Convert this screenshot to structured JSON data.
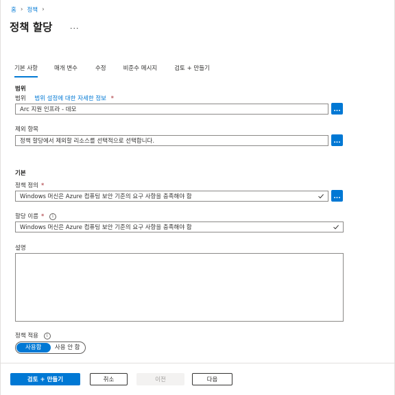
{
  "breadcrumb": {
    "items": [
      "홈",
      "정책"
    ]
  },
  "page": {
    "title": "정책 할당",
    "more": "..."
  },
  "tabs": [
    {
      "label": "기본 사항",
      "active": true
    },
    {
      "label": "매개 변수"
    },
    {
      "label": "수정"
    },
    {
      "label": "비준수 메시지"
    },
    {
      "label": "검토 + 만들기"
    }
  ],
  "scope": {
    "heading": "범위",
    "label": "범위",
    "link": "범위 설정에 대한 자세한 정보",
    "required": "*",
    "value": "Arc 지원 인프라 - 데모",
    "button": "..."
  },
  "exclusions": {
    "label": "제외 항목",
    "value": "정책 할당에서 제외할 리소스를 선택적으로 선택합니다.",
    "button": "..."
  },
  "basics": {
    "heading": "기본",
    "policy_definition": {
      "label": "정책 정의",
      "required": "*",
      "value": "Windows 머신은 Azure 컴퓨팅 보안 기준의 요구 사항을 충족해야 함",
      "button": "..."
    },
    "assignment_name": {
      "label": "할당 이름",
      "required": "*",
      "value": "Windows 머신은 Azure 컴퓨팅 보안 기준의 요구 사항을 충족해야 함"
    },
    "description": {
      "label": "설명",
      "value": ""
    },
    "enforcement": {
      "label": "정책 적용",
      "options": [
        "사용함",
        "사용 안 함"
      ],
      "selected": "사용함"
    }
  },
  "footer": {
    "review_create": "검토 + 만들기",
    "cancel": "취소",
    "previous": "이전",
    "next": "다음"
  },
  "colors": {
    "accent": "#0078d4",
    "required": "#a4262c",
    "border": "#8a8886"
  }
}
